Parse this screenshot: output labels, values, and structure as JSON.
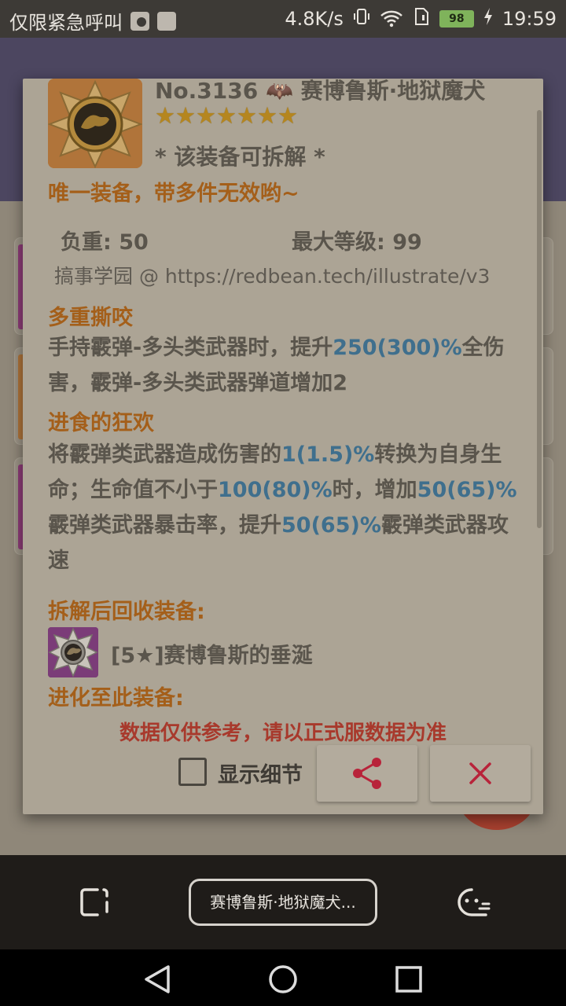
{
  "status_bar": {
    "carrier": "仅限紧急呼叫",
    "net_speed": "4.8K/s",
    "battery": "98",
    "time": "19:59"
  },
  "dialog": {
    "title": "No.3136 🦇 赛博鲁斯·地狱魔犬",
    "stars": "★★★★★★★",
    "dismantle_note": "* 该装备可拆解 *",
    "unique_note": "唯一装备，带多件无效哟~",
    "load_label": "负重: 50",
    "max_level_label": "最大等级: 99",
    "source": "搞事学园 @ https://redbean.tech/illustrate/v3",
    "skill1": {
      "name": "多重撕咬",
      "text_a": "手持霰弹-多头类武器时，提升",
      "hl_a": "250(300)%",
      "text_b": "全伤害，霰弹-多头类武器弹道增加2"
    },
    "skill2": {
      "name": "进食的狂欢",
      "text_a": "将霰弹类武器造成伤害的",
      "hl_a": "1(1.5)%",
      "text_b": "转换为自身生命；生命值不小于",
      "hl_b": "100(80)%",
      "text_c": "时，增加",
      "hl_c": "50(65)%",
      "text_d": "霰弹类武器暴击率，提升",
      "hl_d": "50(65)%",
      "text_e": "霰弹类武器攻速"
    },
    "recycle_title": "拆解后回收装备:",
    "recycle_item": "[5★]赛博鲁斯的垂涎",
    "evolve_title": "进化至此装备:",
    "disclaimer": "数据仅供参考，请以正式服数据为准",
    "show_details_label": "显示细节"
  },
  "bottom_bar": {
    "chip_label": "赛博鲁斯·地狱魔犬..."
  },
  "colors": {
    "accent_orange": "#a45f1a",
    "highlight_blue": "#3f6f8d",
    "warning_red": "#a8392c",
    "close_icon": "#b8233a"
  }
}
